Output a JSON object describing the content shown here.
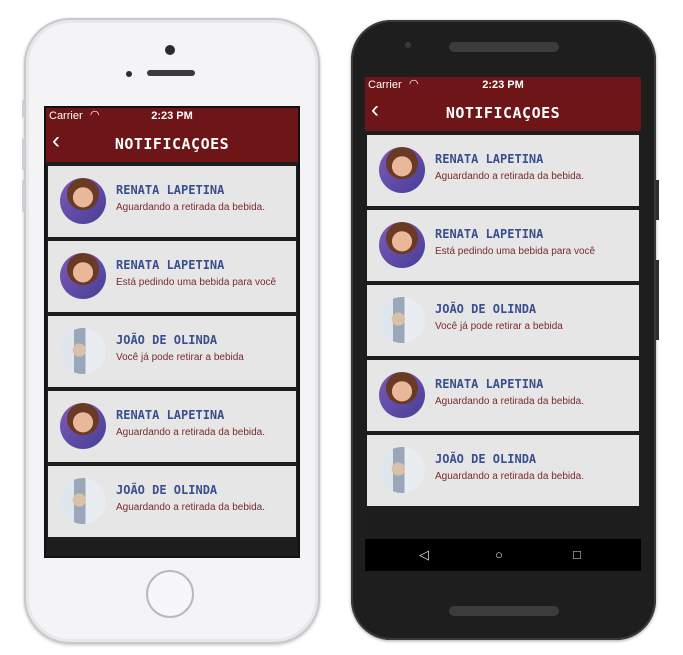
{
  "status": {
    "carrier": "Carrier",
    "time": "2:23 PM"
  },
  "header": {
    "back": "‹",
    "title": "NOTIFICAÇOES"
  },
  "iphone_items": [
    {
      "name": "RENATA LAPETINA",
      "message": "Aguardando a retirada da bebida.",
      "avatar": "f"
    },
    {
      "name": "RENATA LAPETINA",
      "message": "Está pedindo uma bebida para você",
      "avatar": "f"
    },
    {
      "name": "JOÃO DE OLINDA",
      "message": "Você já pode retirar a bebida",
      "avatar": "m"
    },
    {
      "name": "RENATA LAPETINA",
      "message": "Aguardando a retirada da bebida.",
      "avatar": "f"
    },
    {
      "name": "JOÃO DE OLINDA",
      "message": "Aguardando a retirada da bebida.",
      "avatar": "m"
    }
  ],
  "android_items": [
    {
      "name": "RENATA LAPETINA",
      "message": "Aguardando a retirada da bebida.",
      "avatar": "f"
    },
    {
      "name": "RENATA LAPETINA",
      "message": "Está pedindo uma bebida para você",
      "avatar": "f"
    },
    {
      "name": "JOÃO DE OLINDA",
      "message": "Você já pode retirar a bebida",
      "avatar": "m"
    },
    {
      "name": "RENATA LAPETINA",
      "message": "Aguardando a retirada da bebida.",
      "avatar": "f"
    },
    {
      "name": "JOÃO DE OLINDA",
      "message": "Aguardando a retirada da bebida.",
      "avatar": "m"
    }
  ],
  "android_nav": {
    "back": "◁",
    "home": "○",
    "recents": "□"
  },
  "colors": {
    "header": "#6e1518",
    "name": "#3a4f8e",
    "message": "#7b2a2b",
    "card": "#e6e6e6"
  }
}
